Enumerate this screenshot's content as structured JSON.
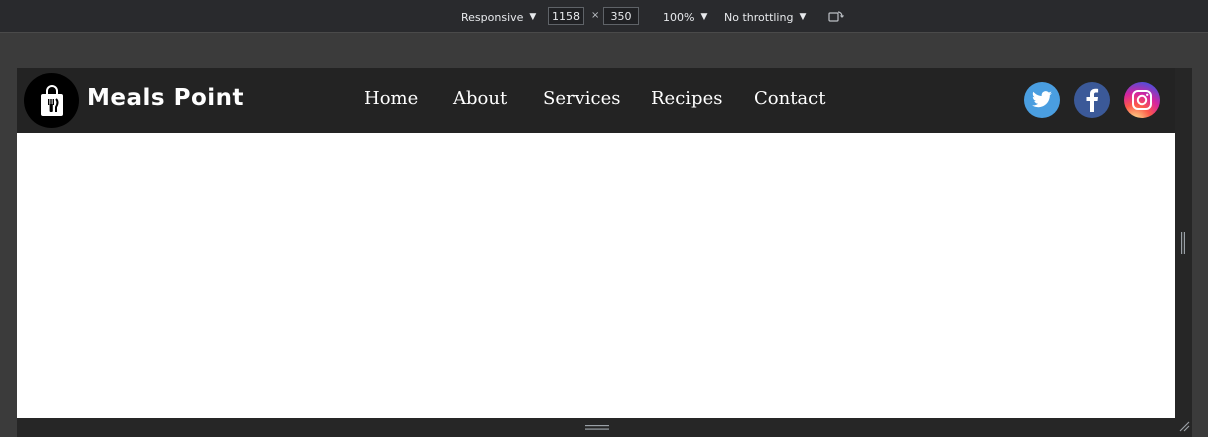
{
  "devtools": {
    "device_label": "Responsive",
    "width_value": "1158",
    "times_sign": "×",
    "height_value": "350",
    "zoom_label": "100%",
    "throttling_label": "No throttling"
  },
  "site": {
    "brand": "Meals Point",
    "nav": [
      "Home",
      "About",
      "Services",
      "Recipes",
      "Contact"
    ],
    "social": [
      "twitter-icon",
      "facebook-icon",
      "instagram-icon"
    ]
  },
  "colors": {
    "header_bg": "#232323",
    "twitter": "#4a9ee0",
    "facebook": "#3b5998"
  }
}
